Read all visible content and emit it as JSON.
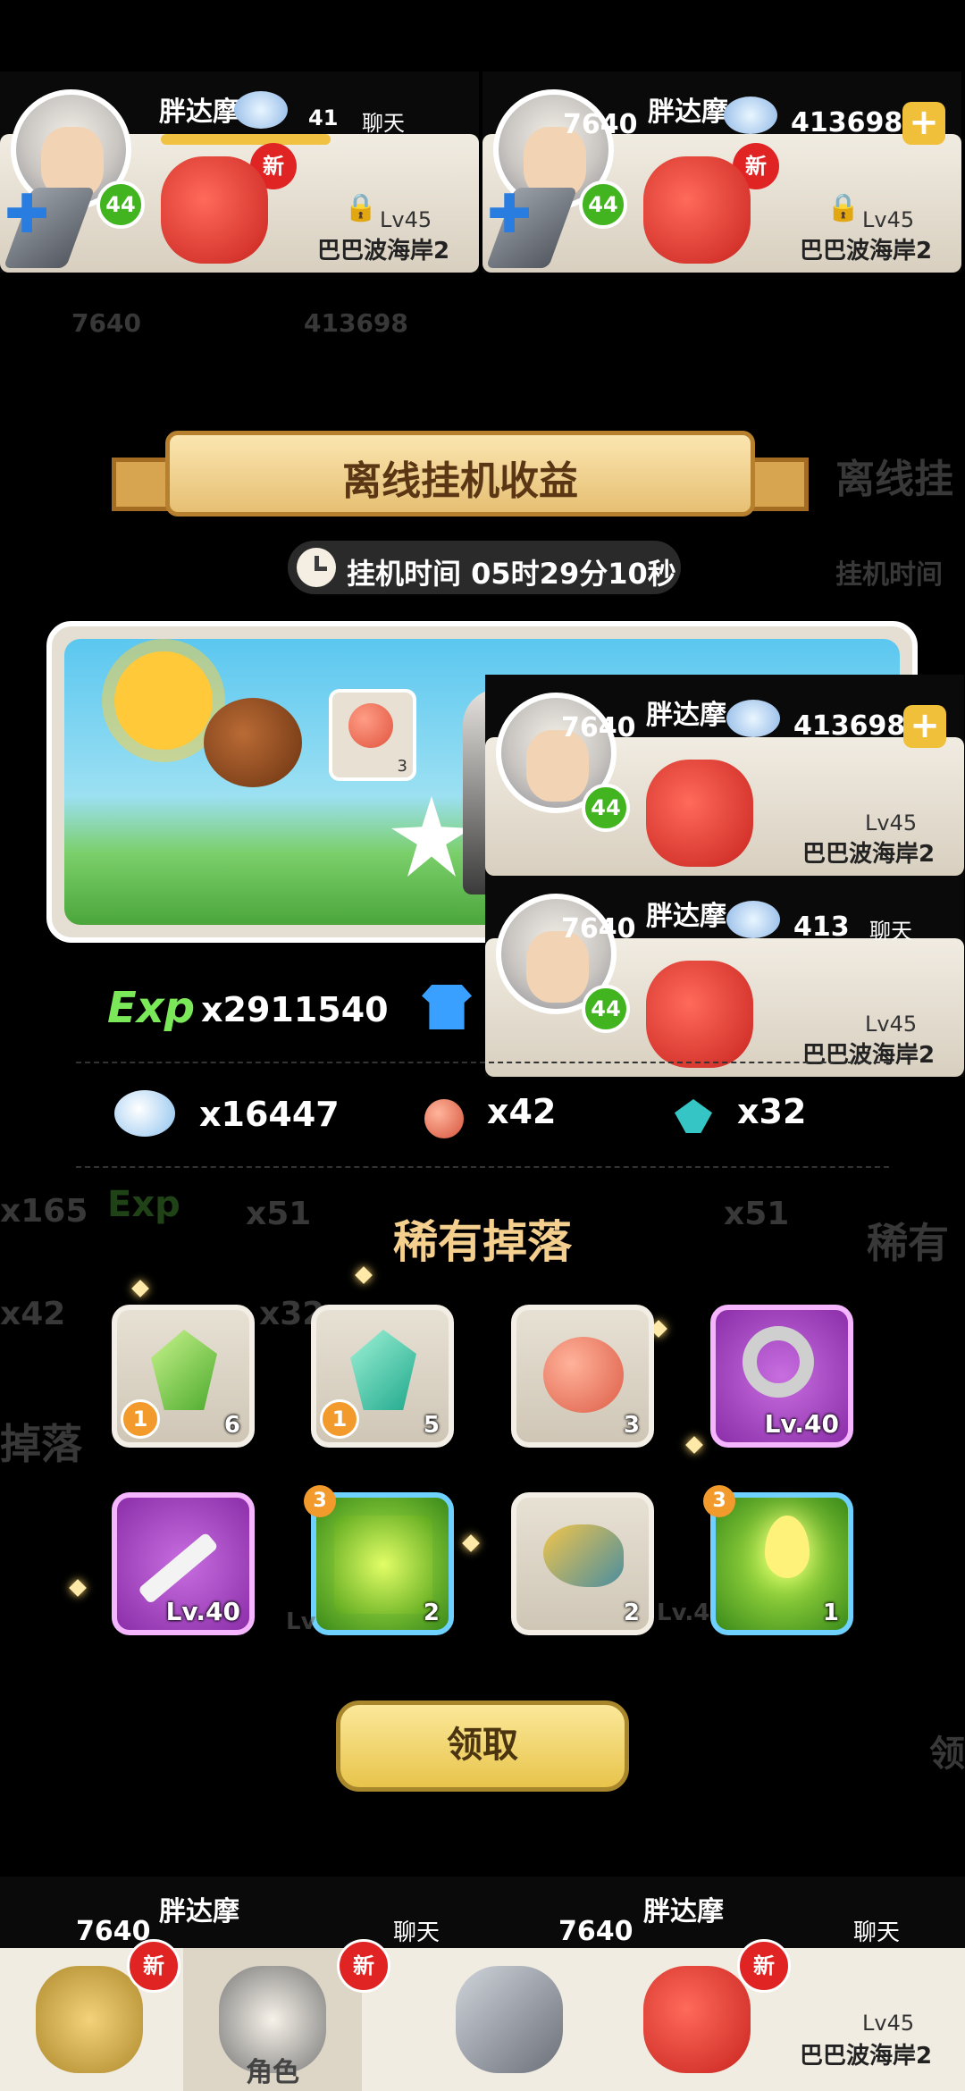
{
  "header": {
    "player_name": "胖达摩",
    "level": "44",
    "coins": "7640",
    "gems": "413698",
    "gems_partial": "41",
    "gems_partial2": "413",
    "chat_label": "聊天",
    "new_badge": "新",
    "map_level": "Lv45",
    "map_region": "巴巴波海岸2"
  },
  "panel": {
    "title": "离线挂机收益",
    "idle_time": "挂机时间 05时29分10秒",
    "ghost_title": "离线挂",
    "ghost_time": "挂机时间",
    "scene_meat_count": "3"
  },
  "rewards": {
    "exp_label": "Exp",
    "exp_value": "x2911540",
    "shells": "x16447",
    "meat": "x42",
    "gems": "x32"
  },
  "ghost_text": {
    "left_165": "x165",
    "left_42": "x42",
    "mid_32": "x32",
    "mid_51": "x51",
    "right_51": "x51",
    "left_drop": "掉落",
    "right_rare": "稀有",
    "right_claim": "领",
    "left_lv": "Lv",
    "mid_lv4": "Lv.4",
    "exp_ghost": "Exp",
    "ghost_7640": "7640",
    "ghost_413698": "413698"
  },
  "rare": {
    "title": "稀有掉落",
    "items": [
      {
        "name": "green-crystal",
        "count": "6",
        "quality": "1"
      },
      {
        "name": "teal-crystal",
        "count": "5",
        "quality": "1"
      },
      {
        "name": "meat",
        "count": "3"
      },
      {
        "name": "ring",
        "level": "Lv.40"
      },
      {
        "name": "dagger",
        "level": "Lv.40"
      },
      {
        "name": "green-scroll",
        "count": "2",
        "star": "3"
      },
      {
        "name": "shrimp",
        "count": "2"
      },
      {
        "name": "green-drop",
        "count": "1",
        "star": "3"
      }
    ]
  },
  "claim_label": "领取",
  "nav": {
    "role_label": "角色",
    "new_badge": "新"
  },
  "colors": {
    "exp_green": "#7be85a",
    "gold": "#f0c03a",
    "purple": "#a040c0",
    "blue": "#6fd1ff"
  }
}
